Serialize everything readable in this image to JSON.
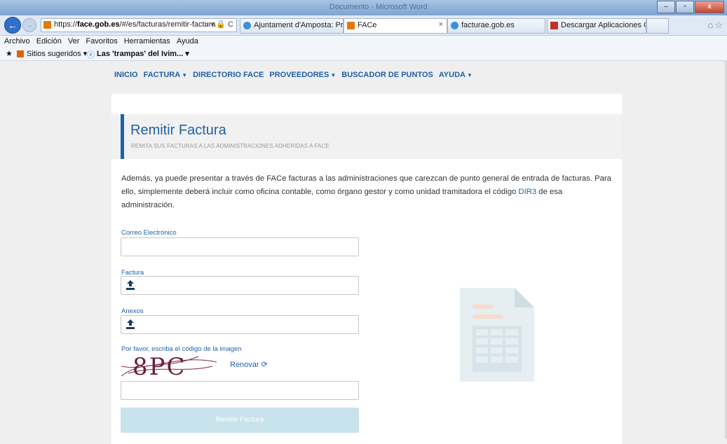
{
  "browser": {
    "window_title": "Documento - Microsoft Word",
    "address": {
      "url_prefix": "https://",
      "url_domain": "face.gob.es",
      "url_path": "/#/es/facturas/remitir-factura",
      "controls": "⌕ ▾ 🔒 C"
    },
    "tabs": [
      {
        "label": "Ajuntament d'Amposta: Prese...",
        "icon": "ie-icon"
      },
      {
        "label": "FACe",
        "icon": "face-favicon",
        "active": true
      },
      {
        "label": "facturae.gob.es",
        "icon": "ie-icon"
      },
      {
        "label": "Descargar Aplicaciones Gestió...",
        "icon": "spain-favicon"
      }
    ],
    "menu": [
      "Archivo",
      "Edición",
      "Ver",
      "Favoritos",
      "Herramientas",
      "Ayuda"
    ],
    "favorites": {
      "suggested": "Sitios sugeridos ▾",
      "page": "Las 'trampas' del Ivim... ▾"
    },
    "win_buttons": {
      "min": "–",
      "max": "▫",
      "close": "x"
    }
  },
  "nav": {
    "items": [
      {
        "label": "INICIO",
        "caret": false
      },
      {
        "label": "FACTURA",
        "caret": true
      },
      {
        "label": "DIRECTORIO FACE",
        "caret": false
      },
      {
        "label": "PROVEEDORES",
        "caret": true
      },
      {
        "label": "BUSCADOR DE PUNTOS",
        "caret": false
      },
      {
        "label": "AYUDA",
        "caret": true
      }
    ]
  },
  "hero": {
    "title": "Remitir Factura",
    "subtitle": "REMITA SUS FACTURAS A LAS ADMINISTRACIONES ADHERIDAS A FACE"
  },
  "intro": {
    "text_before": "Además, ya puede presentar a través de FACe facturas a las administraciones que carezcan de punto general de entrada de facturas. Para ello, simplemente deberá incluir como oficina contable, como órgano gestor y como unidad tramitadora el código ",
    "link": "DIR3",
    "text_after": " de esa administración."
  },
  "form": {
    "email_label": "Correo Electrónico",
    "email_value": "",
    "invoice_label": "Factura",
    "attachments_label": "Anexos",
    "captcha_label": "Por favor, escriba el código de la imagen",
    "captcha_text": "8PC",
    "renew_label": "Renovar",
    "captcha_value": "",
    "submit_label": "Remitir Factura"
  },
  "colors": {
    "primary": "#1f62a7",
    "submit_disabled": "#c8e3eb",
    "hero_bg": "#f1f1f1"
  }
}
